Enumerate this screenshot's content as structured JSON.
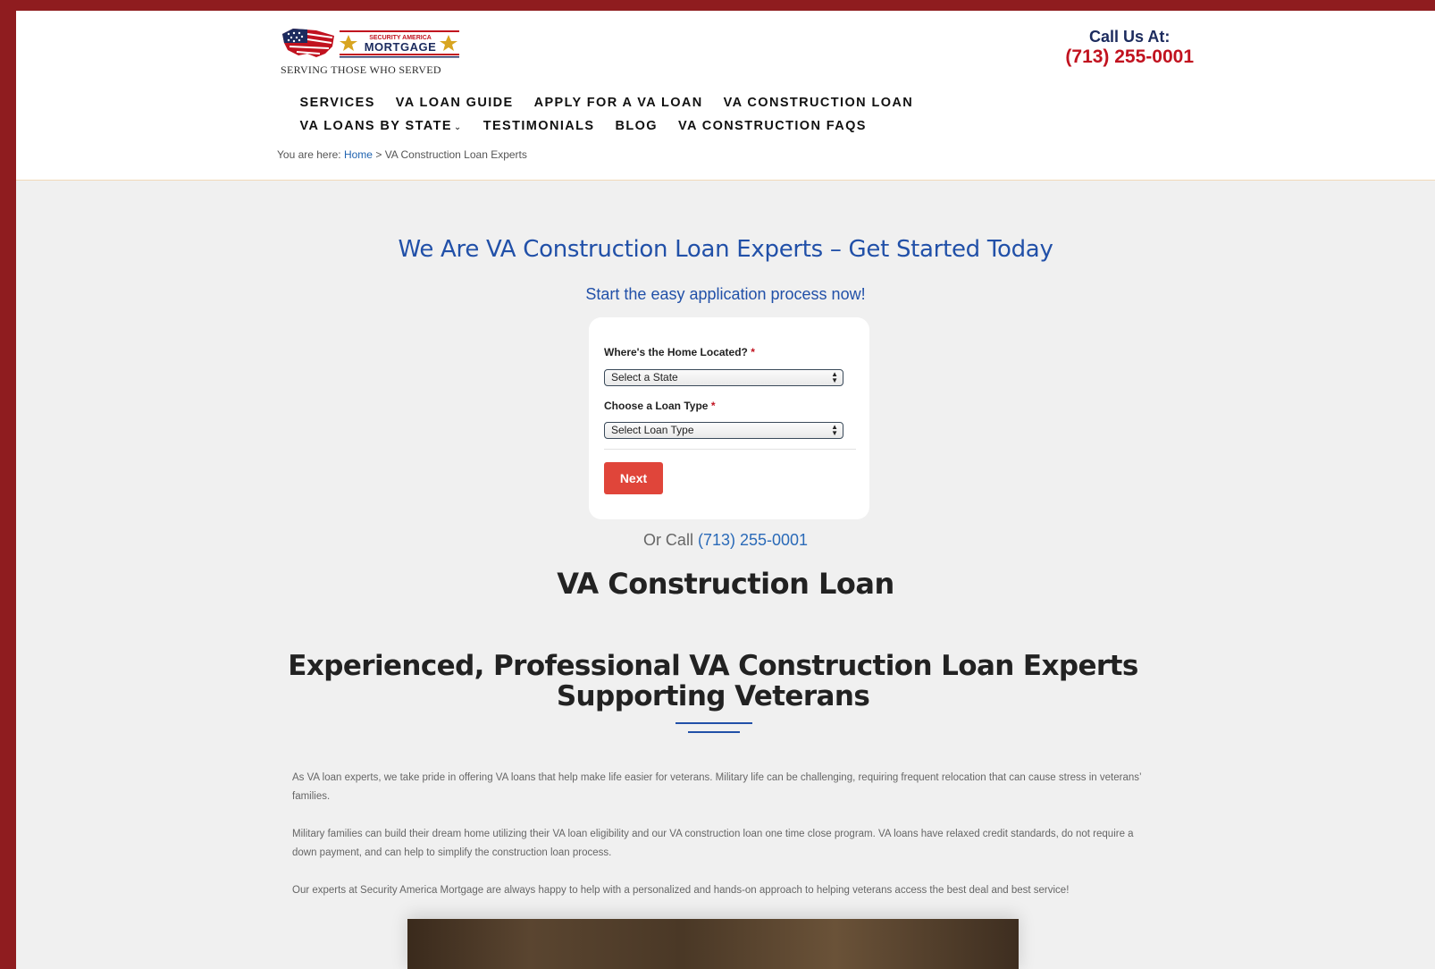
{
  "brand": {
    "logo_top_text": "SECURITY AMERICA",
    "logo_main_text": "MORTGAGE",
    "tagline": "SERVING THOSE WHO SERVED",
    "colors": {
      "red": "#c1121f",
      "navy": "#1c2b5e",
      "blue": "#2150a8",
      "frame": "#8f1c1f",
      "button": "#e0453a"
    }
  },
  "contact": {
    "label": "Call Us At:",
    "phone": "(713) 255-0001"
  },
  "nav": {
    "items": [
      {
        "label": "SERVICES"
      },
      {
        "label": "VA LOAN GUIDE"
      },
      {
        "label": "APPLY FOR A VA LOAN"
      },
      {
        "label": "VA CONSTRUCTION LOAN"
      },
      {
        "label": "VA LOANS BY STATE",
        "icon": "chevron-down-icon"
      },
      {
        "label": "TESTIMONIALS"
      },
      {
        "label": "BLOG"
      },
      {
        "label": "VA CONSTRUCTION FAQS"
      }
    ]
  },
  "breadcrumb": {
    "prefix": "You are here:",
    "home": "Home",
    "separator": ">",
    "current": "VA Construction Loan Experts"
  },
  "hero": {
    "title": "We Are VA Construction Loan Experts – Get Started Today",
    "subtitle": "Start the easy application process now!"
  },
  "form": {
    "state_label": "Where's the Home Located?",
    "required_mark": "*",
    "state_value": "Select a State",
    "loan_label": "Choose a Loan Type",
    "loan_value": "Select Loan Type",
    "next_label": "Next"
  },
  "or_call": {
    "prefix": "Or Call",
    "phone": "(713) 255-0001"
  },
  "content": {
    "title": "VA Construction Loan",
    "heading": "Experienced, Professional VA Construction Loan Experts Supporting Veterans",
    "paragraphs": [
      "As VA loan experts, we take pride in offering VA loans that help make life easier for veterans. Military life can be challenging, requiring frequent relocation that can cause stress in veterans’ families.",
      "Military families can build their dream home utilizing their VA loan eligibility and our VA construction loan one time close program. VA loans have relaxed credit standards, do not require a down payment, and can help to simplify the construction loan process.",
      "Our experts at Security America Mortgage are always happy to help with a personalized and hands-on approach to helping veterans access the best deal and best service!"
    ]
  }
}
